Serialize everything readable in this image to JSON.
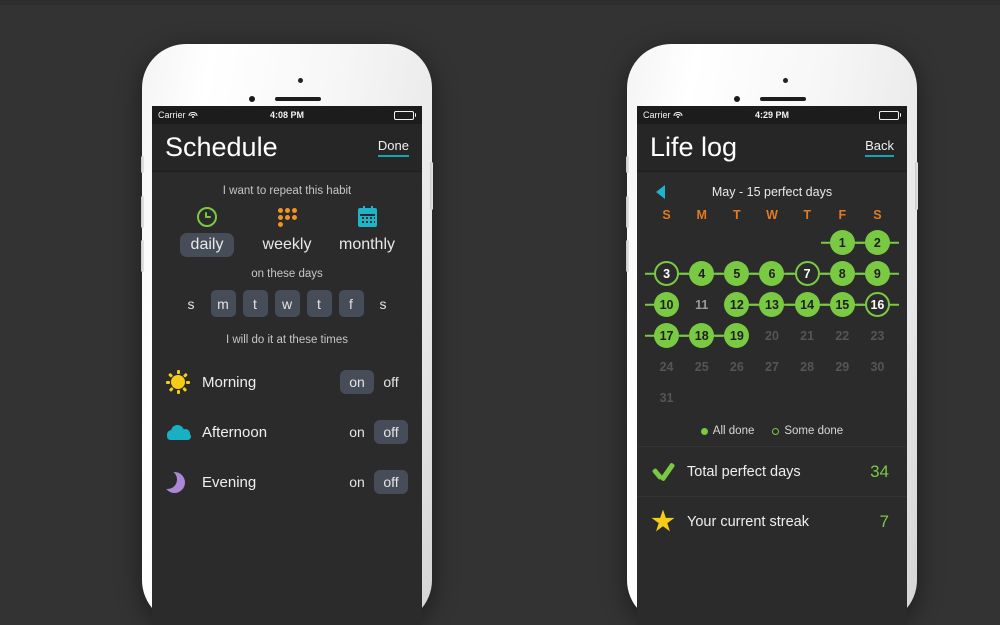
{
  "theme": {
    "page_bg": "#333333",
    "screen_bg": "#2b2b2b",
    "navbar_bg": "#262626",
    "accent_green": "#7ac943",
    "accent_orange": "#e07b21",
    "accent_cyan": "#1cb5c9",
    "accent_yellow": "#f5cd19",
    "accent_purple": "#ab87d6",
    "pill_selected": "#464d59"
  },
  "phones": [
    {
      "id": "schedule",
      "status_bar": {
        "carrier": "Carrier",
        "wifi_icon": "wifi-icon",
        "time": "4:08 PM",
        "battery_icon": "battery-full-icon"
      },
      "navbar": {
        "title": "Schedule",
        "action_label": "Done"
      },
      "repeat_section": {
        "label": "I want to repeat this habit",
        "modes": [
          {
            "label": "daily",
            "icon": "clock-icon",
            "selected": true
          },
          {
            "label": "weekly",
            "icon": "dot-grid-icon",
            "selected": false
          },
          {
            "label": "monthly",
            "icon": "calendar-icon",
            "selected": false
          }
        ]
      },
      "days_section": {
        "label": "on these days",
        "days": [
          {
            "label": "s",
            "on": false
          },
          {
            "label": "m",
            "on": true
          },
          {
            "label": "t",
            "on": true
          },
          {
            "label": "w",
            "on": true
          },
          {
            "label": "t",
            "on": true
          },
          {
            "label": "f",
            "on": true
          },
          {
            "label": "s",
            "on": false
          }
        ]
      },
      "times_section": {
        "label": "I will do it at these times",
        "on_label": "on",
        "off_label": "off",
        "rows": [
          {
            "name": "Morning",
            "icon": "sun-icon",
            "state": "on"
          },
          {
            "name": "Afternoon",
            "icon": "cloud-icon",
            "state": "off"
          },
          {
            "name": "Evening",
            "icon": "moon-icon",
            "state": "off"
          }
        ]
      }
    },
    {
      "id": "lifelog",
      "status_bar": {
        "carrier": "Carrier",
        "wifi_icon": "wifi-icon",
        "time": "4:29 PM",
        "battery_icon": "battery-full-icon"
      },
      "navbar": {
        "title": "Life log",
        "action_label": "Back"
      },
      "calendar": {
        "prev_icon": "chevron-left-icon",
        "month_title": "May - 15 perfect days",
        "weekday_headers": [
          "S",
          "M",
          "T",
          "W",
          "T",
          "F",
          "S"
        ],
        "legend": {
          "all_done": "All done",
          "some_done": "Some done"
        },
        "leading_blanks": 5,
        "days": [
          {
            "n": 1,
            "state": "full",
            "link_left": true,
            "link_right": true
          },
          {
            "n": 2,
            "state": "full",
            "link_left": true,
            "link_right": true
          },
          {
            "n": 3,
            "state": "partial",
            "link_left": true,
            "link_right": true
          },
          {
            "n": 4,
            "state": "full",
            "link_left": true,
            "link_right": true
          },
          {
            "n": 5,
            "state": "full",
            "link_left": true,
            "link_right": true
          },
          {
            "n": 6,
            "state": "full",
            "link_left": true,
            "link_right": true
          },
          {
            "n": 7,
            "state": "partial",
            "link_left": true,
            "link_right": true
          },
          {
            "n": 8,
            "state": "full",
            "link_left": true,
            "link_right": true
          },
          {
            "n": 9,
            "state": "full",
            "link_left": true,
            "link_right": true
          },
          {
            "n": 10,
            "state": "full",
            "link_left": true,
            "link_right": false
          },
          {
            "n": 11,
            "state": "none",
            "link_left": false,
            "link_right": false
          },
          {
            "n": 12,
            "state": "full",
            "link_left": false,
            "link_right": true
          },
          {
            "n": 13,
            "state": "full",
            "link_left": true,
            "link_right": true
          },
          {
            "n": 14,
            "state": "full",
            "link_left": true,
            "link_right": true
          },
          {
            "n": 15,
            "state": "full",
            "link_left": true,
            "link_right": true
          },
          {
            "n": 16,
            "state": "partial",
            "link_left": true,
            "link_right": true
          },
          {
            "n": 17,
            "state": "full",
            "link_left": true,
            "link_right": true
          },
          {
            "n": 18,
            "state": "full",
            "link_left": true,
            "link_right": true
          },
          {
            "n": 19,
            "state": "full",
            "link_left": true,
            "link_right": false
          },
          {
            "n": 20,
            "state": "empty",
            "link_left": false,
            "link_right": false
          },
          {
            "n": 21,
            "state": "empty",
            "link_left": false,
            "link_right": false
          },
          {
            "n": 22,
            "state": "empty",
            "link_left": false,
            "link_right": false
          },
          {
            "n": 23,
            "state": "empty",
            "link_left": false,
            "link_right": false
          },
          {
            "n": 24,
            "state": "empty",
            "link_left": false,
            "link_right": false
          },
          {
            "n": 25,
            "state": "empty",
            "link_left": false,
            "link_right": false
          },
          {
            "n": 26,
            "state": "empty",
            "link_left": false,
            "link_right": false
          },
          {
            "n": 27,
            "state": "empty",
            "link_left": false,
            "link_right": false
          },
          {
            "n": 28,
            "state": "empty",
            "link_left": false,
            "link_right": false
          },
          {
            "n": 29,
            "state": "empty",
            "link_left": false,
            "link_right": false
          },
          {
            "n": 30,
            "state": "empty",
            "link_left": false,
            "link_right": false
          },
          {
            "n": 31,
            "state": "empty",
            "link_left": false,
            "link_right": false
          }
        ]
      },
      "stats": [
        {
          "icon": "check-icon",
          "label": "Total perfect days",
          "value": "34"
        },
        {
          "icon": "star-icon",
          "label": "Your current streak",
          "value": "7"
        }
      ]
    }
  ]
}
